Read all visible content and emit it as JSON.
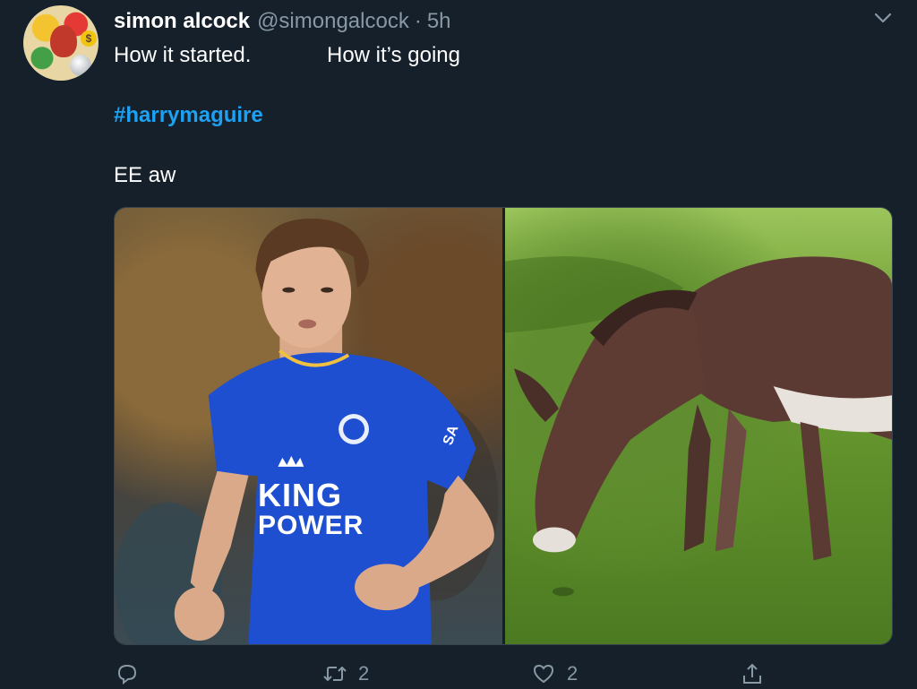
{
  "tweet": {
    "display_name": "simon alcock",
    "handle": "@simongalcock",
    "separator": "·",
    "time": "5h",
    "text_line1_left": "How it started.",
    "text_line1_right": "How it’s going",
    "hashtag": "#harrymaguire",
    "text_line3": "EE aw"
  },
  "avatar": {
    "coin_symbol": "$"
  },
  "media": {
    "left_photo": {
      "shirt_text_line1": "KING",
      "shirt_text_line2": "POWER",
      "sleeve_text": "SA"
    }
  },
  "actions": {
    "reply_count": "",
    "retweet_count": "2",
    "like_count": "2"
  },
  "colors": {
    "background": "#15202b",
    "secondary_text": "#8899a6",
    "link": "#1da1f2"
  },
  "icons": [
    "chevron-down-icon",
    "reply-icon",
    "retweet-icon",
    "like-icon",
    "share-icon"
  ]
}
